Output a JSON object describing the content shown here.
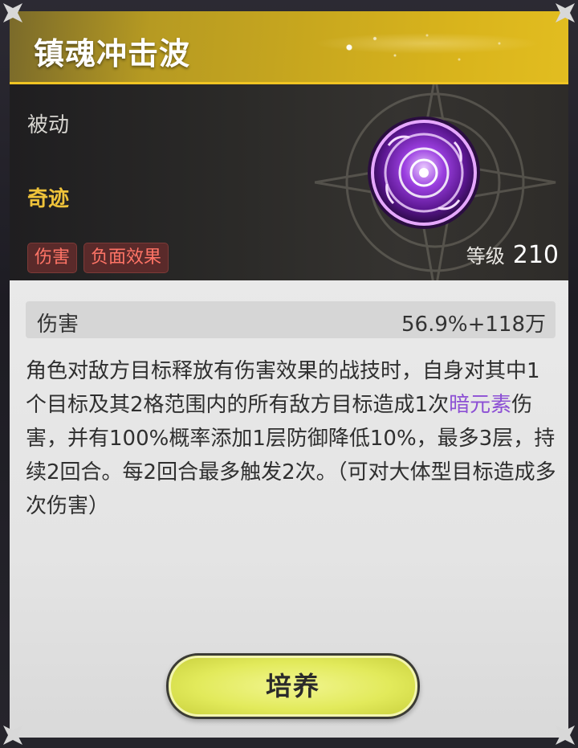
{
  "skill": {
    "title": "镇魂冲击波",
    "type": "被动",
    "path": "奇迹",
    "tags": [
      "伤害",
      "负面效果"
    ],
    "level_label": "等级",
    "level_value": "210"
  },
  "stat": {
    "name": "伤害",
    "value": "56.9%+118万"
  },
  "description": {
    "part1": "角色对敌方目标释放有伤害效果的战技时，自身对其中1个目标及其2格范围内的所有敌方目标造成1次",
    "element": "暗元素",
    "part2": "伤害，并有100%概率添加1层防御降低10%，最多3层，持续2回合。每2回合最多触发2次。（可对大体型目标造成多次伤害）"
  },
  "actions": {
    "cultivate_label": "培养"
  },
  "colors": {
    "header_gold": "#d9b41c",
    "path_gold": "#efc33a",
    "tag_red": "#ff7466",
    "element_purple": "#8c4fd4",
    "button_yellow": "#e2ea5b"
  },
  "icons": {
    "skill_icon": "dark-orb-icon",
    "corner": "corner-star-icon"
  }
}
